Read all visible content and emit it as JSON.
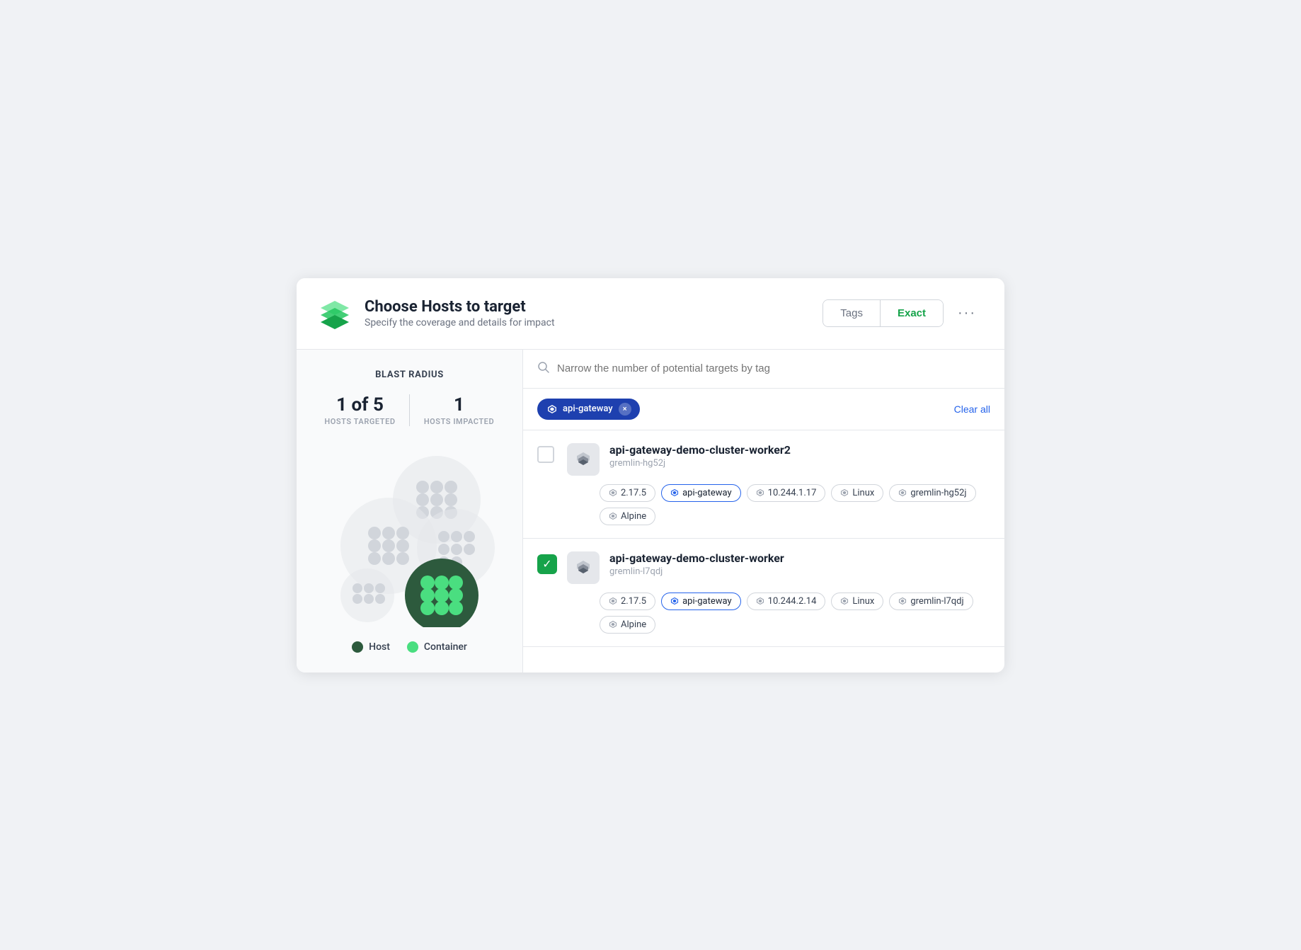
{
  "header": {
    "title": "Choose Hosts to target",
    "subtitle": "Specify the coverage and details for impact",
    "tab_tags_label": "Tags",
    "tab_exact_label": "Exact",
    "tab_active": "Exact",
    "more_icon": "···"
  },
  "left_panel": {
    "blast_radius_label": "BLAST RADIUS",
    "stat1_value": "1 of 5",
    "stat1_label": "HOSTS TARGETED",
    "stat2_value": "1",
    "stat2_label": "HOSTS IMPACTED",
    "legend": {
      "host_label": "Host",
      "container_label": "Container"
    }
  },
  "right_panel": {
    "search_placeholder": "Narrow the number of potential targets by tag",
    "active_tag": "api-gateway",
    "clear_all_label": "Clear all",
    "hosts": [
      {
        "id": "host-1",
        "name": "api-gateway-demo-cluster-worker2",
        "agent": "gremlin-hg52j",
        "checked": false,
        "tags": [
          {
            "label": "2.17.5",
            "active": false
          },
          {
            "label": "api-gateway",
            "active": true
          },
          {
            "label": "10.244.1.17",
            "active": false
          },
          {
            "label": "Linux",
            "active": false
          },
          {
            "label": "gremlin-hg52j",
            "active": false
          },
          {
            "label": "Alpine",
            "active": false
          }
        ]
      },
      {
        "id": "host-2",
        "name": "api-gateway-demo-cluster-worker",
        "agent": "gremlin-l7qdj",
        "checked": true,
        "tags": [
          {
            "label": "2.17.5",
            "active": false
          },
          {
            "label": "api-gateway",
            "active": true
          },
          {
            "label": "10.244.2.14",
            "active": false
          },
          {
            "label": "Linux",
            "active": false
          },
          {
            "label": "gremlin-l7qdj",
            "active": false
          },
          {
            "label": "Alpine",
            "active": false
          }
        ]
      }
    ]
  },
  "icons": {
    "layers_unicode": "◈",
    "search_unicode": "⌕",
    "check_unicode": "✓",
    "close_unicode": "×"
  }
}
